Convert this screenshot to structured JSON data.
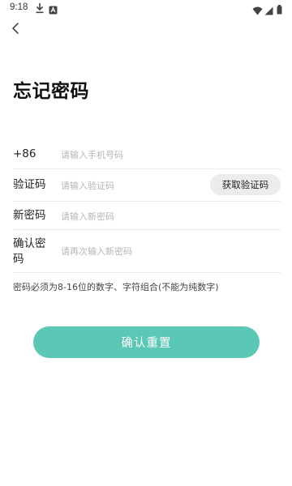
{
  "status_bar": {
    "time": "9:18",
    "icons": [
      "download-icon",
      "app-notification-icon",
      "wifi-icon",
      "signal-icon",
      "battery-icon"
    ]
  },
  "nav": {
    "back_icon": "back-arrow-icon"
  },
  "title": "忘记密码",
  "form": {
    "phone": {
      "label": "+86",
      "placeholder": "请输入手机号码",
      "value": ""
    },
    "code": {
      "label": "验证码",
      "placeholder": "请输入验证码",
      "value": "",
      "button_label": "获取验证码"
    },
    "new_password": {
      "label": "新密码",
      "placeholder": "请输入新密码",
      "value": ""
    },
    "confirm_password": {
      "label": "确认密码",
      "placeholder": "请再次输入新密码",
      "value": ""
    }
  },
  "hint": "密码必须为8-16位的数字、字符组合(不能为纯数字)",
  "submit_label": "确认重置",
  "colors": {
    "accent": "#5ac8b4",
    "code_button_bg": "#ececec",
    "divider": "#ececec",
    "placeholder": "#b6b6b6"
  }
}
